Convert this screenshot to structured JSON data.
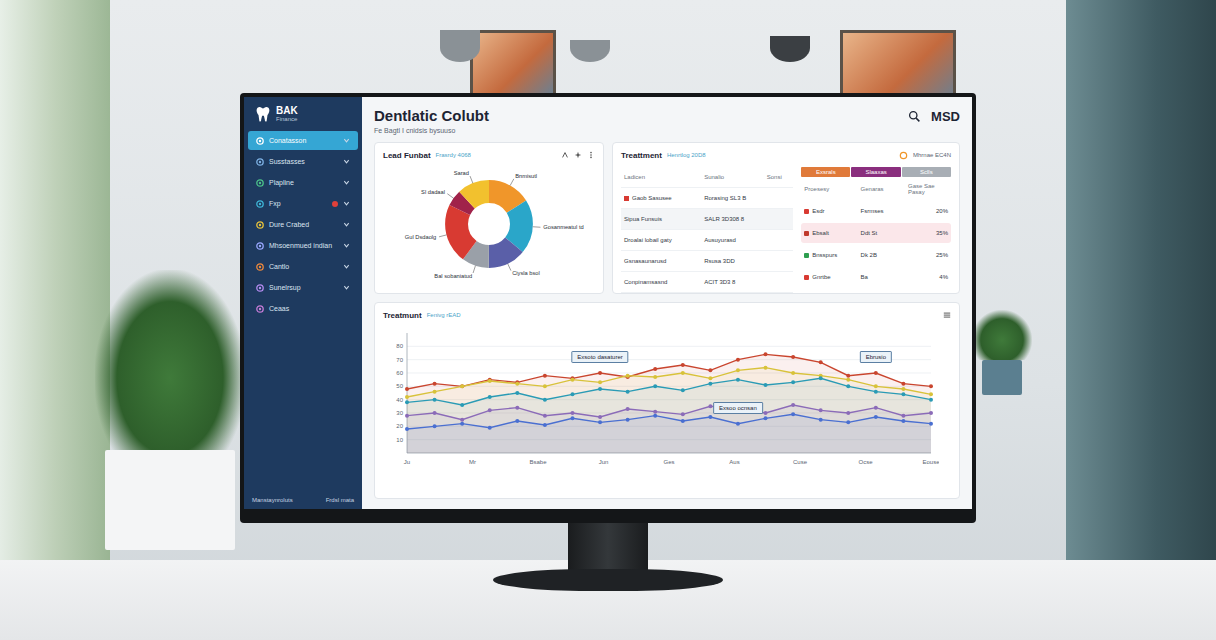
{
  "sidebar": {
    "logo": "BAK",
    "logo_sub": "Finance",
    "items": [
      {
        "label": "Conatasson",
        "selected": true,
        "alert": false,
        "expandable": true,
        "color": "#ffffff"
      },
      {
        "label": "Susstasses",
        "selected": false,
        "alert": false,
        "expandable": true,
        "color": "#7fb2e5"
      },
      {
        "label": "Plapline",
        "selected": false,
        "alert": false,
        "expandable": true,
        "color": "#4cc38a"
      },
      {
        "label": "Fxp",
        "selected": false,
        "alert": true,
        "expandable": true,
        "color": "#3fb6d8"
      },
      {
        "label": "Dure Crabed",
        "selected": false,
        "alert": false,
        "expandable": true,
        "color": "#e9c33b"
      },
      {
        "label": "Mhsoenmued indian",
        "selected": false,
        "alert": false,
        "expandable": true,
        "color": "#9aa8ff"
      },
      {
        "label": "Cantlo",
        "selected": false,
        "alert": false,
        "expandable": true,
        "color": "#f08a3c"
      },
      {
        "label": "Sunelrsup",
        "selected": false,
        "alert": false,
        "expandable": true,
        "color": "#b58cf0"
      },
      {
        "label": "Ceaas",
        "selected": false,
        "alert": false,
        "expandable": false,
        "color": "#c77dd9"
      }
    ],
    "footer": [
      "Manstaynroluts",
      "Frdsl mata"
    ]
  },
  "header": {
    "title": "Dentlatic Colubt",
    "subtitle": "Fe Bagtl I cnidsis bysuuso",
    "action": "MSD"
  },
  "lead_funnel": {
    "title": "Lead Funbat",
    "subtitle": "Frasrdy 4068",
    "slices": [
      {
        "label": "Bnmisutl",
        "value": 16,
        "color": "#f0962a"
      },
      {
        "label": "Gosanmeatul td",
        "value": 20,
        "color": "#2aa6c9"
      },
      {
        "label": "Ciysla bsol",
        "value": 14,
        "color": "#5a5fa8"
      },
      {
        "label": "Bal sobaniatud",
        "value": 10,
        "color": "#9aa0a8"
      },
      {
        "label": "Gul Dsdaolg",
        "value": 22,
        "color": "#d83a32"
      },
      {
        "label": "Sl dadaal",
        "value": 6,
        "color": "#a0224a"
      },
      {
        "label": "Sarad",
        "value": 12,
        "color": "#f2c12e"
      }
    ]
  },
  "treatment": {
    "title": "Treattment",
    "subtitle": "Henrtlog 20D8",
    "badge": "Mhrnae EC4N",
    "columns": [
      "Ladicen",
      "Sunalio",
      "Sonsi"
    ],
    "rows": [
      {
        "cells": [
          "Gaob Sasusee",
          "Rorasing SL3 B",
          ""
        ],
        "highlighted": false,
        "marker": true
      },
      {
        "cells": [
          "Sipua Funsuis",
          "SALR 3D308 8",
          ""
        ],
        "highlighted": true,
        "marker": false
      },
      {
        "cells": [
          "Droalai lobail gaty",
          "Ausuyurasd",
          ""
        ],
        "highlighted": false,
        "marker": false
      },
      {
        "cells": [
          "Gsnasaunarusd",
          "Rsusa 3DD",
          ""
        ],
        "highlighted": false,
        "marker": false
      },
      {
        "cells": [
          "Conpinamsasnd",
          "ACIT 3D3 8",
          ""
        ],
        "highlighted": false,
        "marker": false
      }
    ],
    "tabs": [
      {
        "label": "Exsrals",
        "color": "#e07a3a"
      },
      {
        "label": "Slaaxas",
        "color": "#8a2f7e"
      },
      {
        "label": "Sclls",
        "color": "#a8aeb5"
      }
    ],
    "side_columns": [
      "Proesesy",
      "Genaras",
      "Gase Sae Pasay"
    ],
    "side_rows": [
      {
        "a": "Esdr",
        "b": "Fsrmses",
        "pct": "20%",
        "color": "#d83a32",
        "highlighted": false
      },
      {
        "a": "Ebsalt",
        "b": "Ddt St",
        "pct": "35%",
        "color": "#c0392b",
        "highlighted": true
      },
      {
        "a": "Bnsspurs",
        "b": "Dk 2B",
        "pct": "25%",
        "color": "#2e9e4f",
        "highlighted": false
      },
      {
        "a": "Gnrtbe",
        "b": "Ba",
        "pct": "4%",
        "color": "#d83a32",
        "highlighted": false
      }
    ]
  },
  "trend": {
    "title": "Treatmunt",
    "subtitle": "Fenivg rEAD",
    "y_ticks": [
      "80",
      "70",
      "60",
      "50",
      "40",
      "30",
      "20",
      "10"
    ],
    "x_ticks": [
      "Ju",
      "Mr",
      "Bsabe",
      "Jun",
      "Ges",
      "Aus",
      "Cuse",
      "Ocse",
      "Eouse"
    ],
    "series": [
      {
        "color": "#c9452e",
        "values": [
          48,
          52,
          50,
          55,
          53,
          58,
          56,
          60,
          57,
          63,
          66,
          62,
          70,
          74,
          72,
          68,
          58,
          60,
          52,
          50
        ]
      },
      {
        "color": "#d8c23a",
        "values": [
          42,
          46,
          50,
          54,
          52,
          50,
          55,
          53,
          58,
          57,
          60,
          56,
          62,
          64,
          60,
          58,
          55,
          50,
          48,
          44
        ]
      },
      {
        "color": "#2a9bb5",
        "values": [
          38,
          40,
          36,
          42,
          45,
          40,
          44,
          48,
          46,
          50,
          47,
          52,
          55,
          51,
          53,
          56,
          50,
          46,
          44,
          40
        ]
      },
      {
        "color": "#8b6bb8",
        "values": [
          28,
          30,
          25,
          32,
          34,
          28,
          30,
          27,
          33,
          31,
          29,
          35,
          33,
          30,
          36,
          32,
          30,
          34,
          28,
          30
        ]
      },
      {
        "color": "#4a6fd1",
        "values": [
          18,
          20,
          22,
          19,
          24,
          21,
          26,
          23,
          25,
          28,
          24,
          27,
          22,
          26,
          29,
          25,
          23,
          27,
          24,
          22
        ]
      }
    ],
    "callouts": [
      {
        "label": "Exsoto dasaturer",
        "series": 0,
        "point": 7
      },
      {
        "label": "Ebrusio",
        "series": 0,
        "point": 17
      },
      {
        "label": "Exsoo ocnsan",
        "series": 4,
        "point": 12
      }
    ]
  }
}
